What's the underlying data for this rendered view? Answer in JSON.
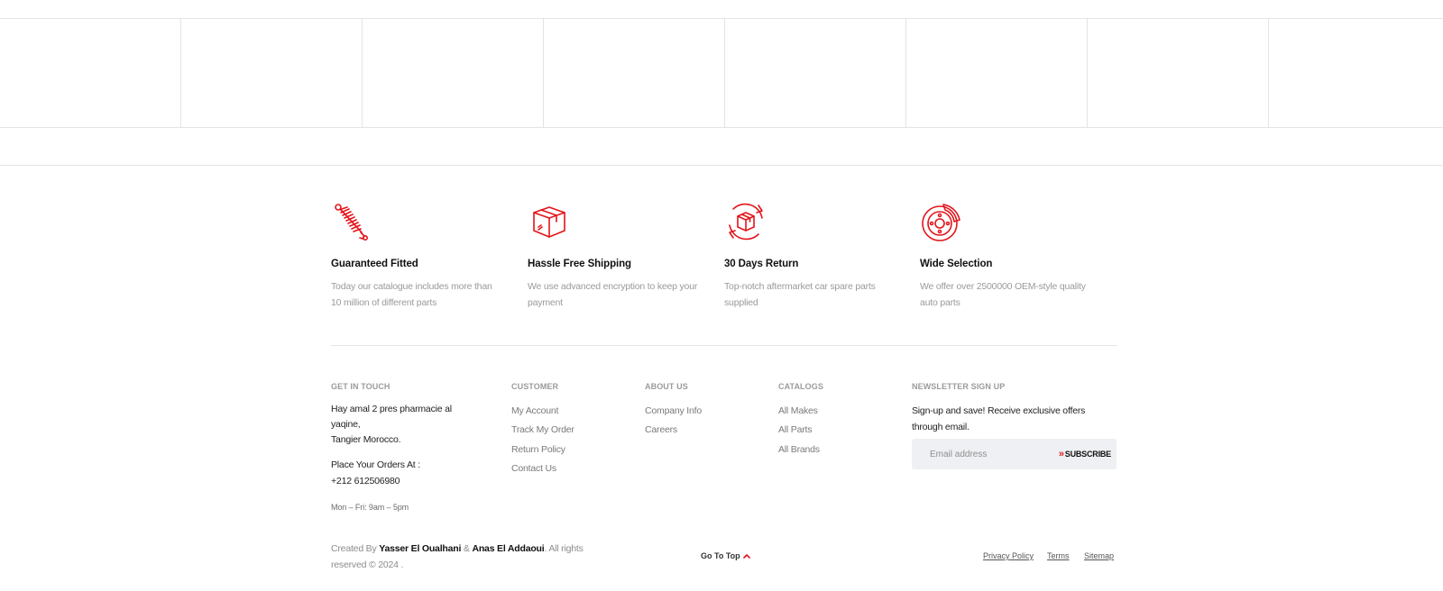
{
  "brand_grid": {
    "cells": 8
  },
  "features": [
    {
      "icon": "shock-absorber-icon",
      "title": "Guaranteed Fitted",
      "desc": "Today our catalogue includes more than 10 million of different parts"
    },
    {
      "icon": "box-icon",
      "title": "Hassle Free Shipping",
      "desc": "We use advanced encryption to keep your payment"
    },
    {
      "icon": "return-box-icon",
      "title": "30 Days Return",
      "desc": "Top-notch aftermarket car spare parts supplied"
    },
    {
      "icon": "brake-disc-icon",
      "title": "Wide Selection",
      "desc": "We offer over 2500000 OEM-style quality auto parts"
    }
  ],
  "get_in_touch": {
    "heading": "GET IN TOUCH",
    "address_line1": "Hay amal 2 pres pharmacie al",
    "address_line2": "yaqine,",
    "address_line3": "Tangier Morocco.",
    "orders_label": "Place Your Orders At :",
    "phone": "+212 612506980",
    "hours": "Mon – Fri: 9am – 5pm"
  },
  "customer": {
    "heading": "CUSTOMER",
    "links": [
      "My Account",
      "Track My Order",
      "Return Policy",
      "Contact Us"
    ]
  },
  "about": {
    "heading": "ABOUT US",
    "links": [
      "Company Info",
      "Careers"
    ]
  },
  "catalogs": {
    "heading": "CATALOGS",
    "links": [
      "All Makes",
      "All Parts",
      "All Brands"
    ]
  },
  "newsletter": {
    "heading": "NEWSLETTER SIGN UP",
    "text": "Sign-up and save! Receive exclusive offers through email.",
    "placeholder": "Email address",
    "button_label": "SUBSCRIBE"
  },
  "bottom": {
    "credits_prefix": "Created By",
    "author1": "Yasser El Oualhani",
    "amp": "&",
    "author2": "Anas El Addaoui",
    "credits_suffix": ". All rights reserved © 2024 .",
    "go_to_top": "Go To Top",
    "privacy": "Privacy Policy",
    "terms": "Terms",
    "sitemap": "Sitemap"
  },
  "colors": {
    "accent": "#e3151a",
    "text": "#111111",
    "muted": "#9a9a9a",
    "border": "#e4e4e4"
  }
}
